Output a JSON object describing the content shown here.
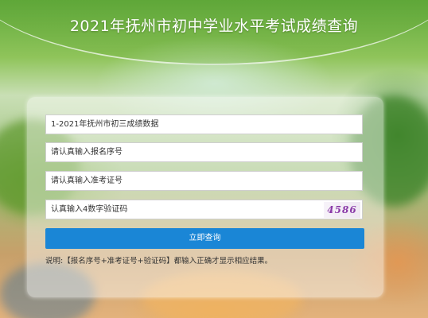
{
  "header": {
    "title": "2021年抚州市初中学业水平考试成绩查询"
  },
  "form": {
    "dataset_select": "1-2021年抚州市初三成绩数据",
    "registration_placeholder": "请认真输入报名序号",
    "exam_ticket_placeholder": "请认真输入准考证号",
    "captcha_placeholder": "认真输入4数字验证码",
    "captcha_code": "4586",
    "submit_label": "立即查询",
    "note": "说明:【报名序号+准考证号+验证码】都输入正确才显示相应结果。"
  },
  "colors": {
    "accent": "#1a86d6",
    "captcha_text": "#8a3aa8"
  }
}
